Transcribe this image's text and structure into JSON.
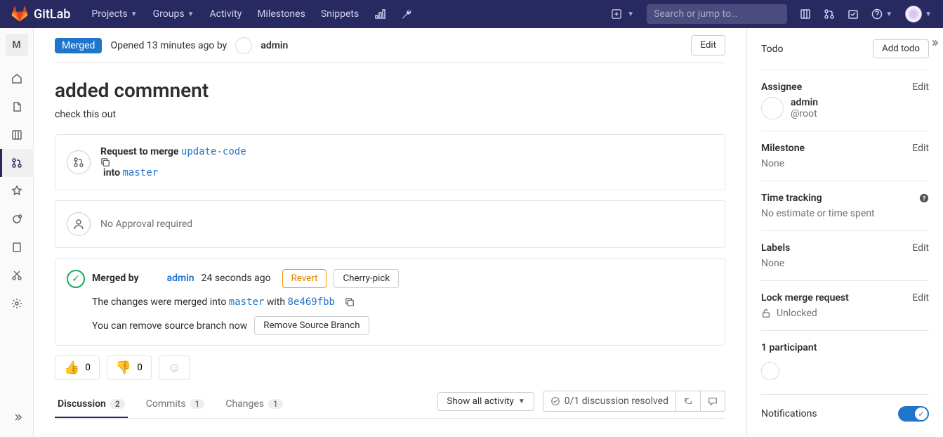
{
  "nav": {
    "brand": "GitLab",
    "links": {
      "projects": "Projects",
      "groups": "Groups",
      "activity": "Activity",
      "milestones": "Milestones",
      "snippets": "Snippets"
    },
    "search_placeholder": "Search or jump to…"
  },
  "left": {
    "project_initial": "M"
  },
  "mr": {
    "status": "Merged",
    "opened_prefix": "Opened ",
    "opened_time": "13 minutes ago",
    "opened_by": " by ",
    "author": "admin",
    "edit": "Edit",
    "title": "added commnent",
    "description": "check this out"
  },
  "mergebox": {
    "request_prefix": "Request to merge ",
    "source_branch": "update-code",
    "into": " into ",
    "target_branch": "master"
  },
  "approval": {
    "text": "No Approval required"
  },
  "merged": {
    "prefix": "Merged by ",
    "user": "admin",
    "time": " 24 seconds ago",
    "revert": "Revert",
    "cherry": "Cherry-pick",
    "changes_prefix": "The changes were merged into ",
    "with": " with ",
    "sha": "8e469fbb",
    "remove_hint": "You can remove source branch now",
    "remove_btn": "Remove Source Branch"
  },
  "reactions": {
    "thumbs_up": "0",
    "thumbs_down": "0"
  },
  "tabs": {
    "discussion": "Discussion",
    "discussion_count": "2",
    "commits": "Commits",
    "commits_count": "1",
    "changes": "Changes",
    "changes_count": "1",
    "show_all": "Show all activity",
    "resolved": "0/1 discussion resolved"
  },
  "sidebar": {
    "todo": {
      "label": "Todo",
      "button": "Add todo"
    },
    "assignee": {
      "label": "Assignee",
      "edit": "Edit",
      "name": "admin",
      "handle": "@root"
    },
    "milestone": {
      "label": "Milestone",
      "edit": "Edit",
      "value": "None"
    },
    "timetracking": {
      "label": "Time tracking",
      "value": "No estimate or time spent"
    },
    "labels": {
      "label": "Labels",
      "edit": "Edit",
      "value": "None"
    },
    "lock": {
      "label": "Lock merge request",
      "edit": "Edit",
      "value": "Unlocked"
    },
    "participants": {
      "label": "1 participant"
    },
    "notifications": {
      "label": "Notifications"
    }
  }
}
